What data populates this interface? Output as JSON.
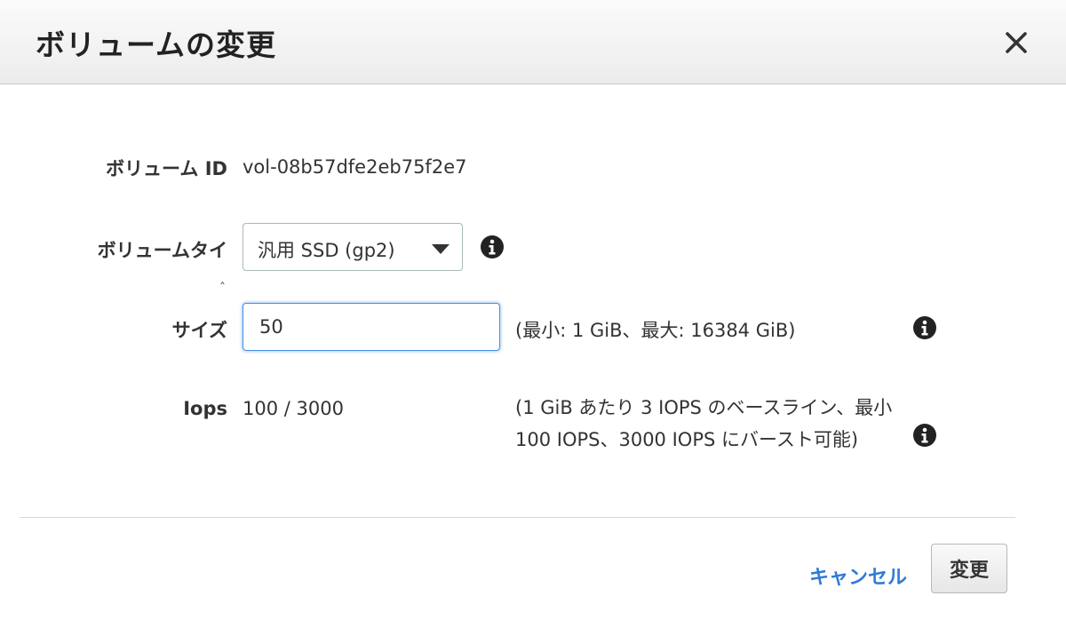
{
  "dialog": {
    "title": "ボリュームの変更",
    "close_icon": "close-icon"
  },
  "fields": {
    "volume_id": {
      "label": "ボリューム ID",
      "value": "vol-08b57dfe2eb75f2e7"
    },
    "volume_type": {
      "label": "ボリュームタイ",
      "label_overflow": "ˆ",
      "selected": "汎用 SSD (gp2)",
      "info_icon": "info-icon"
    },
    "size": {
      "label": "サイズ",
      "value": "50",
      "hint": "(最小: 1 GiB、最大: 16384 GiB)",
      "info_icon": "info-icon"
    },
    "iops": {
      "label": "Iops",
      "value": "100 / 3000",
      "hint": "(1 GiB あたり 3 IOPS のベースライン、最小 100 IOPS、3000 IOPS にバースト可能)",
      "info_icon": "info-icon"
    }
  },
  "footer": {
    "cancel_label": "キャンセル",
    "submit_label": "変更"
  },
  "colors": {
    "link": "#2f7bd6",
    "focus": "#4a90e2",
    "text": "#333333"
  }
}
